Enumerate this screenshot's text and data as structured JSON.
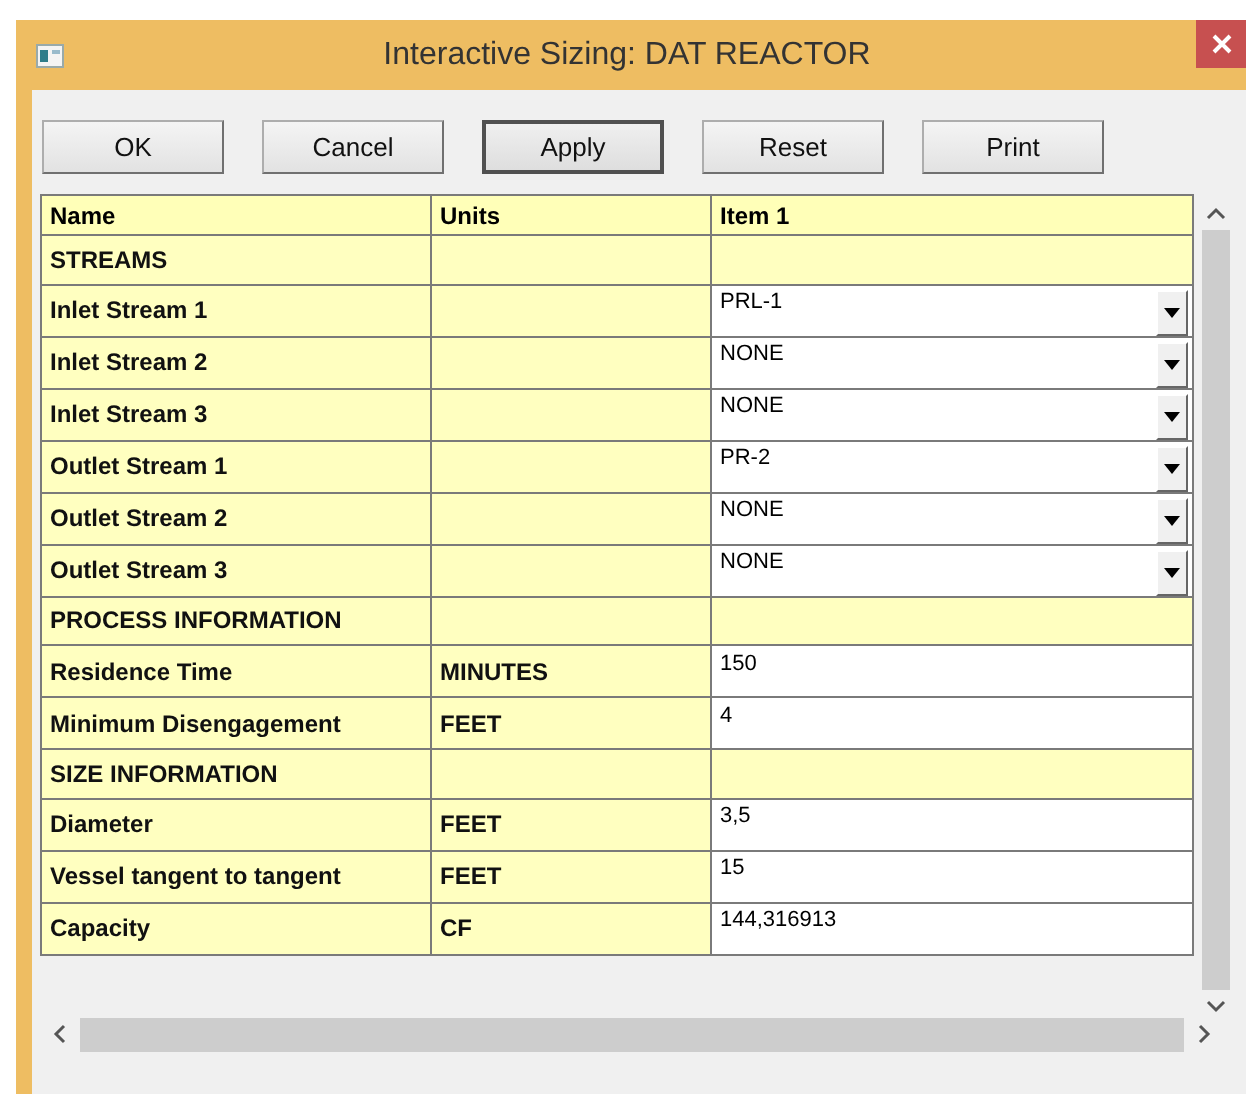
{
  "window": {
    "title": "Interactive Sizing: DAT REACTOR"
  },
  "buttons": [
    {
      "label": "OK",
      "default": false
    },
    {
      "label": "Cancel",
      "default": false
    },
    {
      "label": "Apply",
      "default": true
    },
    {
      "label": "Reset",
      "default": false
    },
    {
      "label": "Print",
      "default": false
    }
  ],
  "table": {
    "columns": [
      "Name",
      "Units",
      "Item 1"
    ],
    "rows": [
      {
        "kind": "section",
        "name": "STREAMS"
      },
      {
        "kind": "dropdown",
        "name": "Inlet Stream 1",
        "value": "PRL-1"
      },
      {
        "kind": "dropdown",
        "name": "Inlet Stream 2",
        "value": "NONE"
      },
      {
        "kind": "dropdown",
        "name": "Inlet Stream 3",
        "value": "NONE"
      },
      {
        "kind": "dropdown",
        "name": "Outlet Stream 1",
        "value": "PR-2"
      },
      {
        "kind": "dropdown",
        "name": "Outlet Stream 2",
        "value": "NONE"
      },
      {
        "kind": "dropdown",
        "name": "Outlet Stream 3",
        "value": "NONE"
      },
      {
        "kind": "section",
        "name": "PROCESS INFORMATION"
      },
      {
        "kind": "input",
        "name": "Residence Time",
        "units": "MINUTES",
        "value": "150"
      },
      {
        "kind": "input",
        "name": "Minimum Disengagement",
        "units": "FEET",
        "value": "4"
      },
      {
        "kind": "section",
        "name": "SIZE INFORMATION"
      },
      {
        "kind": "input",
        "name": "Diameter",
        "units": "FEET",
        "value": "3,5"
      },
      {
        "kind": "input",
        "name": "Vessel tangent to tangent",
        "units": "FEET",
        "value": "15"
      },
      {
        "kind": "input",
        "name": "Capacity",
        "units": "CF",
        "value": "144,316913"
      }
    ]
  }
}
